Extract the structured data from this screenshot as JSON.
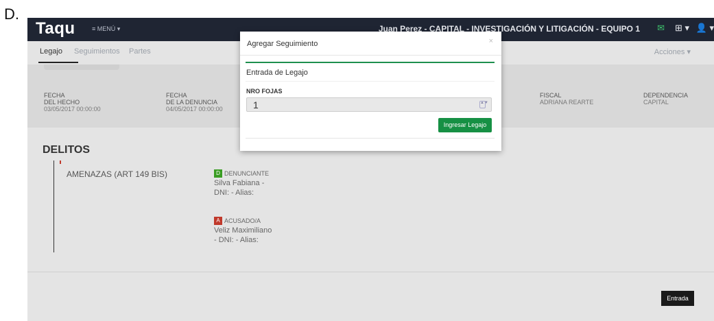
{
  "outer_label": "D.",
  "navbar": {
    "brand": "Taqu",
    "menu_label": "≡  MENÚ ▾",
    "user_text": "Juan Perez - CAPITAL - INVESTIGACIÓN Y LITIGACIÓN - EQUIPO 1",
    "inbox_icon": "✉",
    "plus_menu": "⊞ ▾",
    "user_menu": "👤 ▾"
  },
  "tabs": [
    {
      "label": "Legajo"
    },
    {
      "label": "Seguimientos"
    },
    {
      "label": "Partes"
    }
  ],
  "acciones_label": "Acciones ▾",
  "info": [
    {
      "label1": "FECHA",
      "label2": "DEL HECHO",
      "value": "03/05/2017 00:00:00"
    },
    {
      "label1": "FECHA",
      "label2": "DE LA DENUNCIA",
      "value": "04/05/2017 00:00:00"
    },
    {
      "label1": "FISCAL",
      "label2": "",
      "value": "ADRIANA REARTE"
    },
    {
      "label1": "DEPENDENCIA",
      "label2": "",
      "value": "CAPITAL"
    }
  ],
  "delitos": {
    "title": "DELITOS",
    "items": [
      {
        "name": "AMENAZAS (ART 149 BIS)",
        "personas": [
          {
            "badge": "D",
            "role": "DENUNCIANTE",
            "line1": "Silva Fabiana -",
            "line2": "DNI: - Alias:"
          },
          {
            "badge": "A",
            "role": "ACUSADO/A",
            "line1": "Veliz Maximiliano",
            "line2": "- DNI: - Alias:"
          }
        ]
      }
    ]
  },
  "entrada_button": "Entrada",
  "modal": {
    "title": "Agregar Seguimiento",
    "close": "×",
    "card_title": "Entrada de Legajo",
    "field_label": "NRO FOJAS",
    "field_value": "1",
    "spinner": "▲▼",
    "submit_label": "Ingresar Legajo"
  },
  "colors": {
    "navbar": "#1f2533",
    "accent_green": "#169044",
    "badge_denunciante": "#3a9d23",
    "badge_acusado": "#c0392b"
  }
}
